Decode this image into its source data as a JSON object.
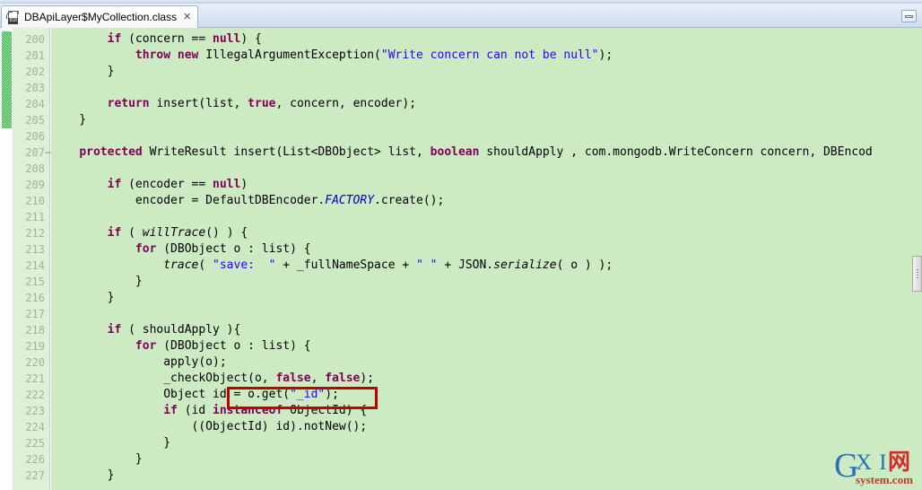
{
  "window": {
    "minimize_label": "Minimize"
  },
  "tab": {
    "title": "DBApiLayer$MyCollection.class",
    "close_glyph": "✕",
    "icon_bits": "010"
  },
  "editor": {
    "first_line": 200,
    "line_height": 18,
    "changed_lines": [
      200,
      201,
      202,
      203,
      204,
      205
    ],
    "fold_marker_lines": [
      207
    ],
    "fold_marker_glyph": "−",
    "colors": {
      "code_background": "#ccebc3",
      "gutter_background": "#ddf0d8",
      "line_number": "#9fb49b",
      "keyword": "#7f0055",
      "string": "#2a00ff",
      "static_field": "#0000c0",
      "change_marker": "#39b54a",
      "highlight_border": "#c00000"
    },
    "lines": [
      {
        "n": "200",
        "text": "        if (concern == null) {"
      },
      {
        "n": "201",
        "text": "            throw new IllegalArgumentException(\"Write concern can not be null\");"
      },
      {
        "n": "202",
        "text": "        }"
      },
      {
        "n": "203",
        "text": ""
      },
      {
        "n": "204",
        "text": "        return insert(list, true, concern, encoder);"
      },
      {
        "n": "205",
        "text": "    }"
      },
      {
        "n": "206",
        "text": ""
      },
      {
        "n": "207",
        "text": "    protected WriteResult insert(List<DBObject> list, boolean shouldApply , com.mongodb.WriteConcern concern, DBEncod"
      },
      {
        "n": "208",
        "text": ""
      },
      {
        "n": "209",
        "text": "        if (encoder == null)"
      },
      {
        "n": "210",
        "text": "            encoder = DefaultDBEncoder.FACTORY.create();"
      },
      {
        "n": "211",
        "text": ""
      },
      {
        "n": "212",
        "text": "        if ( willTrace() ) {"
      },
      {
        "n": "213",
        "text": "            for (DBObject o : list) {"
      },
      {
        "n": "214",
        "text": "                trace( \"save:  \" + _fullNameSpace + \" \" + JSON.serialize( o ) );"
      },
      {
        "n": "215",
        "text": "            }"
      },
      {
        "n": "216",
        "text": "        }"
      },
      {
        "n": "217",
        "text": ""
      },
      {
        "n": "218",
        "text": "        if ( shouldApply ){"
      },
      {
        "n": "219",
        "text": "            for (DBObject o : list) {"
      },
      {
        "n": "220",
        "text": "                apply(o);"
      },
      {
        "n": "221",
        "text": "                _checkObject(o, false, false);"
      },
      {
        "n": "222",
        "text": "                Object id = o.get(\"_id\");"
      },
      {
        "n": "223",
        "text": "                if (id instanceof ObjectId) {"
      },
      {
        "n": "224",
        "text": "                    ((ObjectId) id).notNew();"
      },
      {
        "n": "225",
        "text": "                }"
      },
      {
        "n": "226",
        "text": "            }"
      },
      {
        "n": "227",
        "text": "        }"
      }
    ],
    "highlight": {
      "line": "222",
      "snippet": "o.get(\"_id\");"
    }
  },
  "scrollbar": {
    "orientation": "vertical"
  },
  "watermark": {
    "g": "G",
    "xi": "X I",
    "cn": "网",
    "domain": "system.com"
  }
}
